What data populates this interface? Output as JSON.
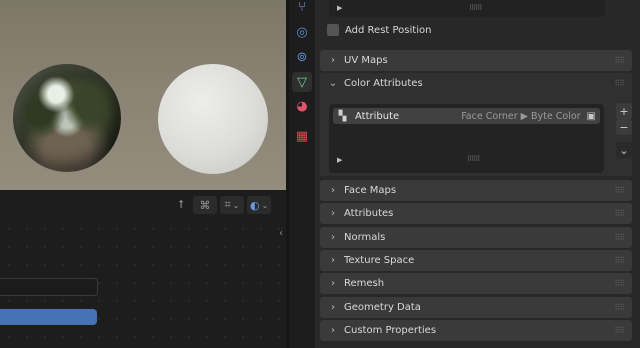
{
  "left": {
    "toolbar_icons": [
      "cursor-icon",
      "snap-icon",
      "grid-icon",
      "overlay-icon"
    ]
  },
  "tabs": [
    {
      "icon": "constraint-icon",
      "glyph": "⛓",
      "color": "#7aa4d8"
    },
    {
      "icon": "physics-icon",
      "glyph": "◎",
      "color": "#5d8fd6"
    },
    {
      "icon": "particles-icon",
      "glyph": "⬤",
      "color": "#5d8fd6"
    },
    {
      "icon": "mesh-data-icon",
      "glyph": "△",
      "color": "#6fd18f",
      "selected": true
    },
    {
      "icon": "material-icon",
      "glyph": "◕",
      "color": "#e0536b"
    },
    {
      "icon": "texture-icon",
      "glyph": "▦",
      "color": "#d94a4a"
    }
  ],
  "properties": {
    "add_rest_position": "Add Rest Position",
    "panels": {
      "uv_maps": "UV Maps",
      "color_attributes": "Color Attributes",
      "face_maps": "Face Maps",
      "attributes": "Attributes",
      "normals": "Normals",
      "texture_space": "Texture Space",
      "remesh": "Remesh",
      "geometry_data": "Geometry Data",
      "custom_properties": "Custom Properties"
    },
    "color_attribute_item": {
      "name": "Attribute",
      "domain": "Face Corner ▶ Byte Color"
    },
    "side_buttons": {
      "add": "+",
      "remove": "−",
      "menu": "⌄"
    }
  },
  "colors": {
    "accent_blue": "#4772b3",
    "panel_bg": "#3a3a3a",
    "editor_bg": "#282828"
  }
}
